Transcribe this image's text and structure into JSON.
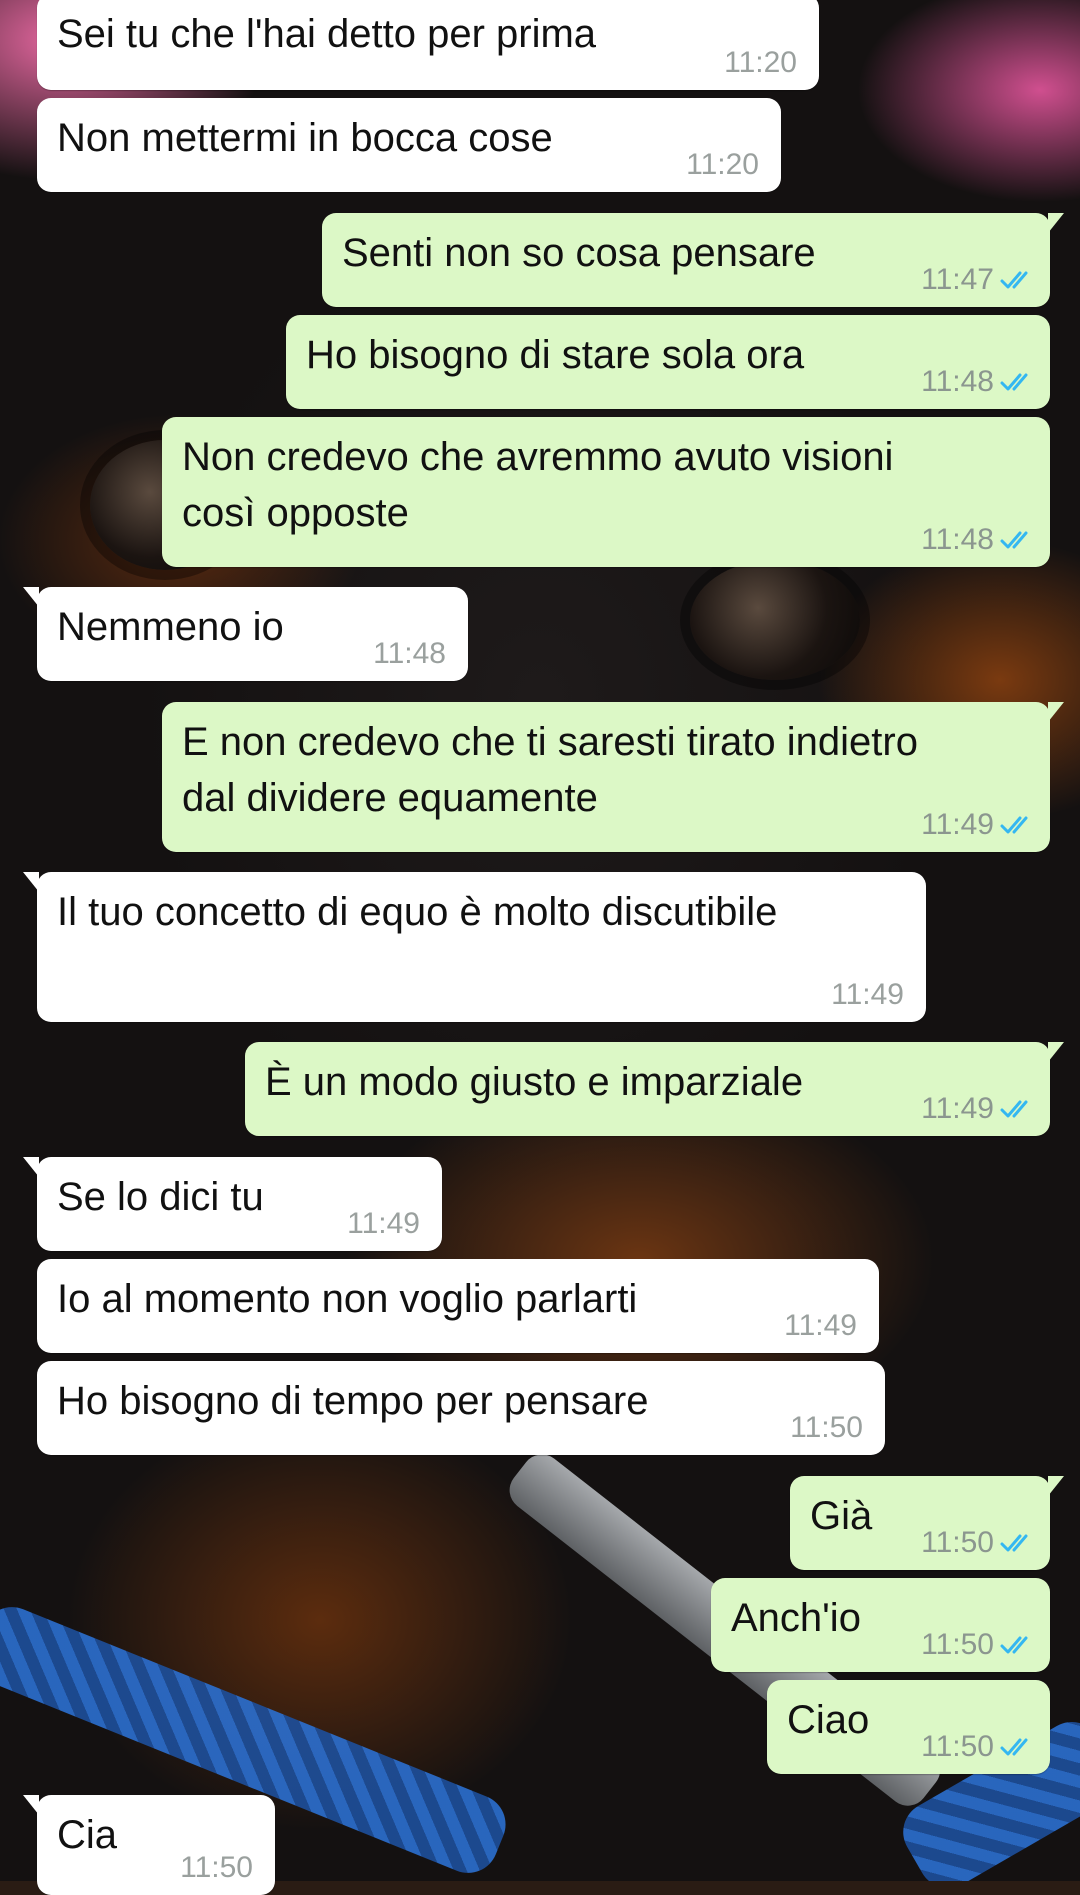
{
  "messages": [
    {
      "dir": "in",
      "text": "Sei tu che l'hai detto per prima",
      "time": "11:20",
      "read": false
    },
    {
      "dir": "in",
      "text": "Non mettermi in bocca cose",
      "time": "11:20",
      "read": false
    },
    {
      "dir": "out",
      "text": "Senti non so cosa pensare",
      "time": "11:47",
      "read": true
    },
    {
      "dir": "out",
      "text": "Ho bisogno di stare sola ora",
      "time": "11:48",
      "read": true
    },
    {
      "dir": "out",
      "text": "Non credevo che avremmo avuto visioni\ncosì opposte",
      "time": "11:48",
      "read": true
    },
    {
      "dir": "in",
      "text": "Nemmeno io",
      "time": "11:48",
      "read": false
    },
    {
      "dir": "out",
      "text": "E non credevo che ti saresti tirato indietro\ndal dividere equamente",
      "time": "11:49",
      "read": true
    },
    {
      "dir": "in",
      "text": "Il tuo concetto di equo è molto discutibile",
      "time": "11:49",
      "read": false
    },
    {
      "dir": "out",
      "text": "È un modo giusto e imparziale",
      "time": "11:49",
      "read": true
    },
    {
      "dir": "in",
      "text": "Se lo dici tu",
      "time": "11:49",
      "read": false
    },
    {
      "dir": "in",
      "text": "Io al momento non voglio parlarti",
      "time": "11:49",
      "read": false
    },
    {
      "dir": "in",
      "text": "Ho bisogno di tempo per pensare",
      "time": "11:50",
      "read": false
    },
    {
      "dir": "out",
      "text": "Già",
      "time": "11:50",
      "read": true
    },
    {
      "dir": "out",
      "text": "Anch'io",
      "time": "11:50",
      "read": true
    },
    {
      "dir": "out",
      "text": "Ciao",
      "time": "11:50",
      "read": true
    },
    {
      "dir": "in",
      "text": "Cia",
      "time": "11:50",
      "read": false
    }
  ],
  "colors": {
    "incoming_bubble": "#ffffff",
    "outgoing_bubble": "#dcf8c6",
    "read_ticks": "#34b7f1",
    "timestamp": "#8b968f"
  },
  "icons": {
    "read_receipt": "double-check-icon"
  }
}
